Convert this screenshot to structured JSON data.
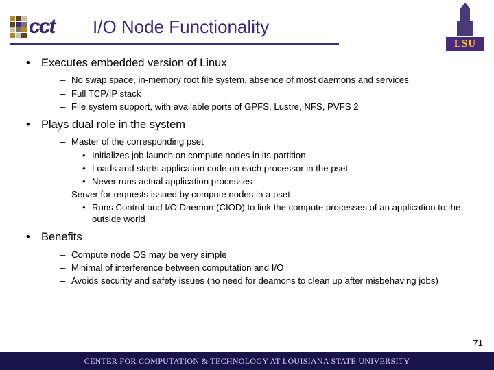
{
  "header": {
    "cct_label": "cct",
    "title": "I/O Node Functionality",
    "lsu_label": "LSU"
  },
  "sections": [
    {
      "head": "Executes embedded version of Linux",
      "items": [
        {
          "type": "dash",
          "text": "No swap space, in-memory root file system, absence of most daemons and services"
        },
        {
          "type": "dash",
          "text": "Full TCP/IP stack"
        },
        {
          "type": "dash",
          "text": "File system support, with available ports of GPFS, Lustre, NFS, PVFS 2"
        }
      ]
    },
    {
      "head": "Plays dual role in the system",
      "items": [
        {
          "type": "dash",
          "text": "Master of the corresponding pset"
        },
        {
          "type": "dot",
          "text": "Initializes job launch on compute nodes in its partition"
        },
        {
          "type": "dot",
          "text": "Loads and starts application code on each processor in the pset"
        },
        {
          "type": "dot",
          "text": "Never runs actual application processes"
        },
        {
          "type": "dash",
          "text": "Server for requests issued by compute nodes in a pset"
        },
        {
          "type": "dot",
          "text": "Runs Control and I/O Daemon (CIOD) to link the compute processes of an application to the outside world"
        }
      ]
    },
    {
      "head": "Benefits",
      "items": [
        {
          "type": "dash",
          "text": "Compute node OS may be very simple"
        },
        {
          "type": "dash",
          "text": "Minimal of interference between computation and I/O"
        },
        {
          "type": "dash",
          "text": "Avoids security and safety issues (no need for deamons to clean up after misbehaving jobs)"
        }
      ]
    }
  ],
  "page_number": "71",
  "footer": "CENTER FOR COMPUTATION & TECHNOLOGY AT LOUISIANA STATE UNIVERSITY"
}
